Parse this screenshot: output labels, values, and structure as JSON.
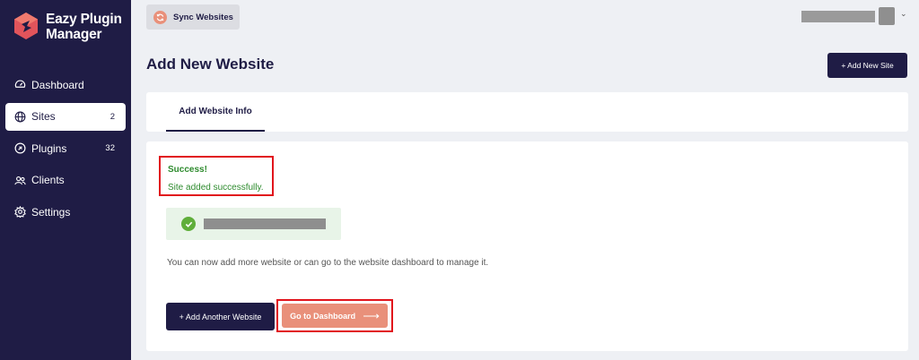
{
  "brand": {
    "line1": "Eazy Plugin",
    "line2": "Manager"
  },
  "sidebar": {
    "items": [
      {
        "label": "Dashboard",
        "icon": "gauge-icon",
        "badge": ""
      },
      {
        "label": "Sites",
        "icon": "globe-icon",
        "badge": "2"
      },
      {
        "label": "Plugins",
        "icon": "plugin-icon",
        "badge": "32"
      },
      {
        "label": "Clients",
        "icon": "users-icon",
        "badge": ""
      },
      {
        "label": "Settings",
        "icon": "gear-icon",
        "badge": ""
      }
    ],
    "active": "Sites"
  },
  "topbar": {
    "sync_label": "Sync Websites"
  },
  "header": {
    "title": "Add New Website",
    "add_site_label": "+ Add New Site"
  },
  "tabs": [
    {
      "label": "Add Website Info"
    }
  ],
  "alert": {
    "title": "Success!",
    "message": "Site added successfully."
  },
  "info_text": "You can now add more website or can go to the website dashboard to manage it.",
  "actions": {
    "add_another_label": "+ Add Another Website",
    "go_dashboard_label": "Go to Dashboard"
  },
  "colors": {
    "sidebar": "#1f1c45",
    "accent": "#e9907a",
    "success": "#2e8b2e",
    "highlight": "#e1141c"
  }
}
